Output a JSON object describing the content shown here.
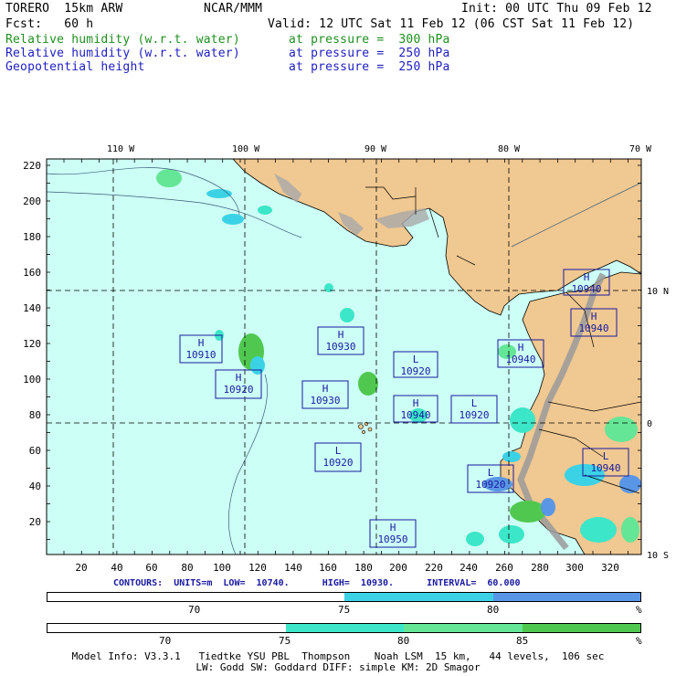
{
  "header": {
    "model": "TORERO  15km ARW",
    "org": "NCAR/MMM",
    "init": "Init: 00 UTC Thu 09 Feb 12",
    "fcst": "Fcst:   60 h",
    "valid": "Valid: 12 UTC Sat 11 Feb 12 (06 CST Sat 11 Feb 12)"
  },
  "fields": [
    {
      "name": "Relative humidity (w.r.t. water)",
      "level": "at pressure =  300 hPa",
      "color": "#1f8f1f"
    },
    {
      "name": "Relative humidity (w.r.t. water)",
      "level": "at pressure =  250 hPa",
      "color": "#2020c0"
    },
    {
      "name": "Geopotential height",
      "level": "at pressure =  250 hPa",
      "color": "#000000"
    }
  ],
  "axes": {
    "top_lon": [
      "110 W",
      "100 W",
      "90 W",
      "80 W",
      "70 W"
    ],
    "right_lat": [
      "10 N",
      "0",
      "10 S"
    ],
    "y_ticks": [
      "220",
      "200",
      "180",
      "160",
      "140",
      "120",
      "100",
      "80",
      "60",
      "40",
      "20"
    ],
    "x_ticks": [
      "20",
      "40",
      "60",
      "80",
      "100",
      "120",
      "140",
      "160",
      "180",
      "200",
      "220",
      "240",
      "260",
      "280",
      "300",
      "320"
    ]
  },
  "highs_lows": [
    {
      "type": "H",
      "value": "10910"
    },
    {
      "type": "H",
      "value": "10920"
    },
    {
      "type": "H",
      "value": "10930"
    },
    {
      "type": "H",
      "value": "10930"
    },
    {
      "type": "L",
      "value": "10920"
    },
    {
      "type": "H",
      "value": "10940"
    },
    {
      "type": "L",
      "value": "10920"
    },
    {
      "type": "H",
      "value": "10940"
    },
    {
      "type": "H",
      "value": "10940"
    },
    {
      "type": "H",
      "value": "10940"
    },
    {
      "type": "L",
      "value": "10920"
    },
    {
      "type": "L",
      "value": "10920"
    },
    {
      "type": "L",
      "value": "10940"
    },
    {
      "type": "H",
      "value": "10950"
    }
  ],
  "contour_info": "CONTOURS:  UNITS=m  LOW=  10740.      HIGH=  10930.      INTERVAL=  60.000",
  "colorbar1": {
    "labels": [
      "70",
      "75",
      "80"
    ],
    "unit": "%",
    "colors": [
      "#ffffff",
      "#3cd2e6",
      "#5a96e6"
    ]
  },
  "colorbar2": {
    "labels": [
      "70",
      "75",
      "80",
      "85"
    ],
    "unit": "%",
    "colors": [
      "#ffffff",
      "#3ce6c8",
      "#64e696",
      "#50c850"
    ]
  },
  "footer": {
    "line1": "Model Info: V3.3.1   Tiedtke YSU PBL  Thompson    Noah LSM  15 km,   44 levels,  106 sec",
    "line2": "LW: Godd SW: Goddard DIFF: simple KM: 2D Smagor"
  },
  "colors": {
    "ocean": "#ccfff5",
    "land": "#f0c891",
    "terrain": "#a0a0a0",
    "box": "#1a1aa0"
  }
}
